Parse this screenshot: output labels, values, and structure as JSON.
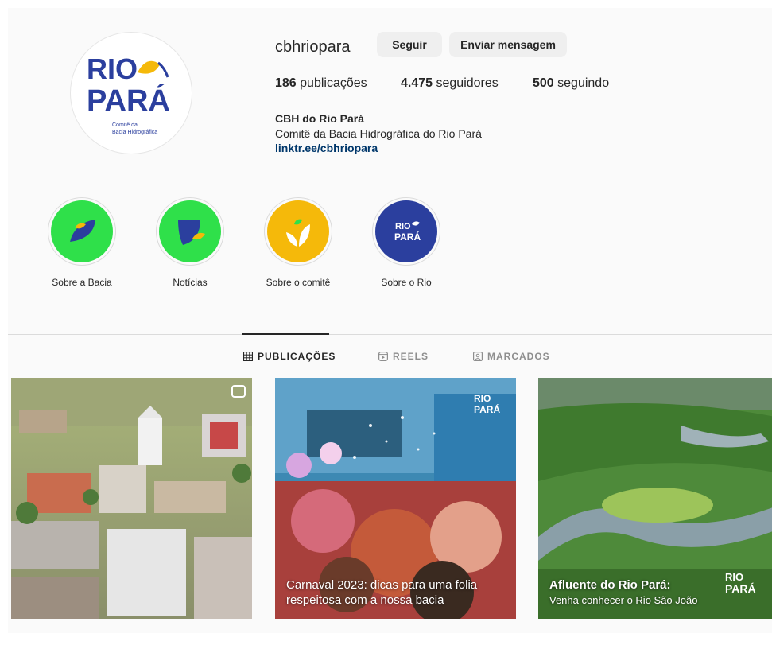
{
  "profile": {
    "username": "cbhriopara",
    "follow_label": "Seguir",
    "message_label": "Enviar mensagem",
    "posts_count": "186",
    "posts_label": "publicações",
    "followers_count": "4.475",
    "followers_label": "seguidores",
    "following_count": "500",
    "following_label": "seguindo",
    "display_name": "CBH do Rio Pará",
    "bio": "Comitê da Bacia Hidrográfica do Rio Pará",
    "link": "linktr.ee/cbhriopara",
    "logo_line1": "RIO",
    "logo_line2": "PARÁ",
    "logo_sub1": "Comitê da",
    "logo_sub2": "Bacia Hidrográfica"
  },
  "highlights": [
    {
      "label": "Sobre a Bacia",
      "color": "#2fe04a"
    },
    {
      "label": "Notícias",
      "color": "#2fe04a"
    },
    {
      "label": "Sobre o comitê",
      "color": "#f5b90a"
    },
    {
      "label": "Sobre o Rio",
      "color": "#2b3f9e"
    }
  ],
  "tabs": [
    {
      "label": "PUBLICAÇÕES",
      "icon": "grid-icon"
    },
    {
      "label": "REELS",
      "icon": "reels-icon"
    },
    {
      "label": "MARCADOS",
      "icon": "tagged-icon"
    }
  ],
  "posts": [
    {
      "caption": ""
    },
    {
      "caption_line1": "Carnaval 2023: dicas para uma folia",
      "caption_line2": "respeitosa com a nossa bacia"
    },
    {
      "caption_line1": "Afluente do Rio Pará:",
      "caption_line2": "Venha conhecer o Rio São João"
    }
  ],
  "colors": {
    "brand_blue": "#2b3f9e",
    "brand_yellow": "#f5b90a",
    "brand_green": "#2fe04a",
    "link": "#00376b"
  }
}
